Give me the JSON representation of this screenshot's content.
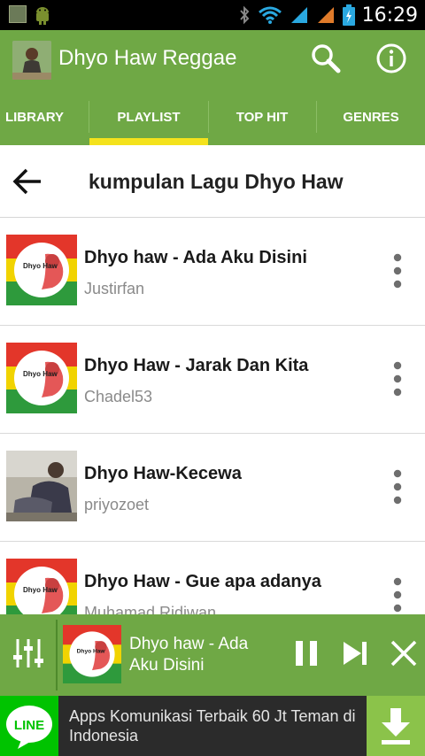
{
  "status_bar": {
    "time": "16:29"
  },
  "app_bar": {
    "title": "Dhyo Haw Reggae",
    "search_icon": "search-icon",
    "info_icon": "info-icon"
  },
  "tabs": [
    {
      "label": "LIBRARY",
      "active": false
    },
    {
      "label": "PLAYLIST",
      "active": true
    },
    {
      "label": "TOP HIT",
      "active": false
    },
    {
      "label": "GENRES",
      "active": false
    }
  ],
  "playlist": {
    "title": "kumpulan Lagu Dhyo Haw",
    "back_icon": "arrow-back-icon",
    "items": [
      {
        "title": "Dhyo haw - Ada Aku Disini",
        "uploader": "Justirfan",
        "thumb": "reggae-cover"
      },
      {
        "title": "Dhyo Haw - Jarak Dan Kita",
        "uploader": "Chadel53",
        "thumb": "reggae-cover"
      },
      {
        "title": "Dhyo Haw-Kecewa",
        "uploader": "priyozoet",
        "thumb": "photo"
      },
      {
        "title": "Dhyo Haw - Gue apa adanya",
        "uploader": "Muhamad Ridiwan",
        "thumb": "reggae-cover"
      }
    ]
  },
  "player": {
    "now_playing": "Dhyo haw - Ada Aku Disini",
    "equalizer_icon": "equalizer-icon",
    "pause_icon": "pause-icon",
    "next_icon": "skip-next-icon",
    "close_icon": "close-icon"
  },
  "ad": {
    "logo_text": "LINE",
    "text": "Apps Komunikasi Terbaik 60 Jt Teman di Indonesia",
    "download_icon": "download-icon"
  },
  "cover_text": "Dhyo Haw",
  "colors": {
    "primary": "#6fa845",
    "tab_indicator": "#f4e21c",
    "line_green": "#00c300"
  }
}
